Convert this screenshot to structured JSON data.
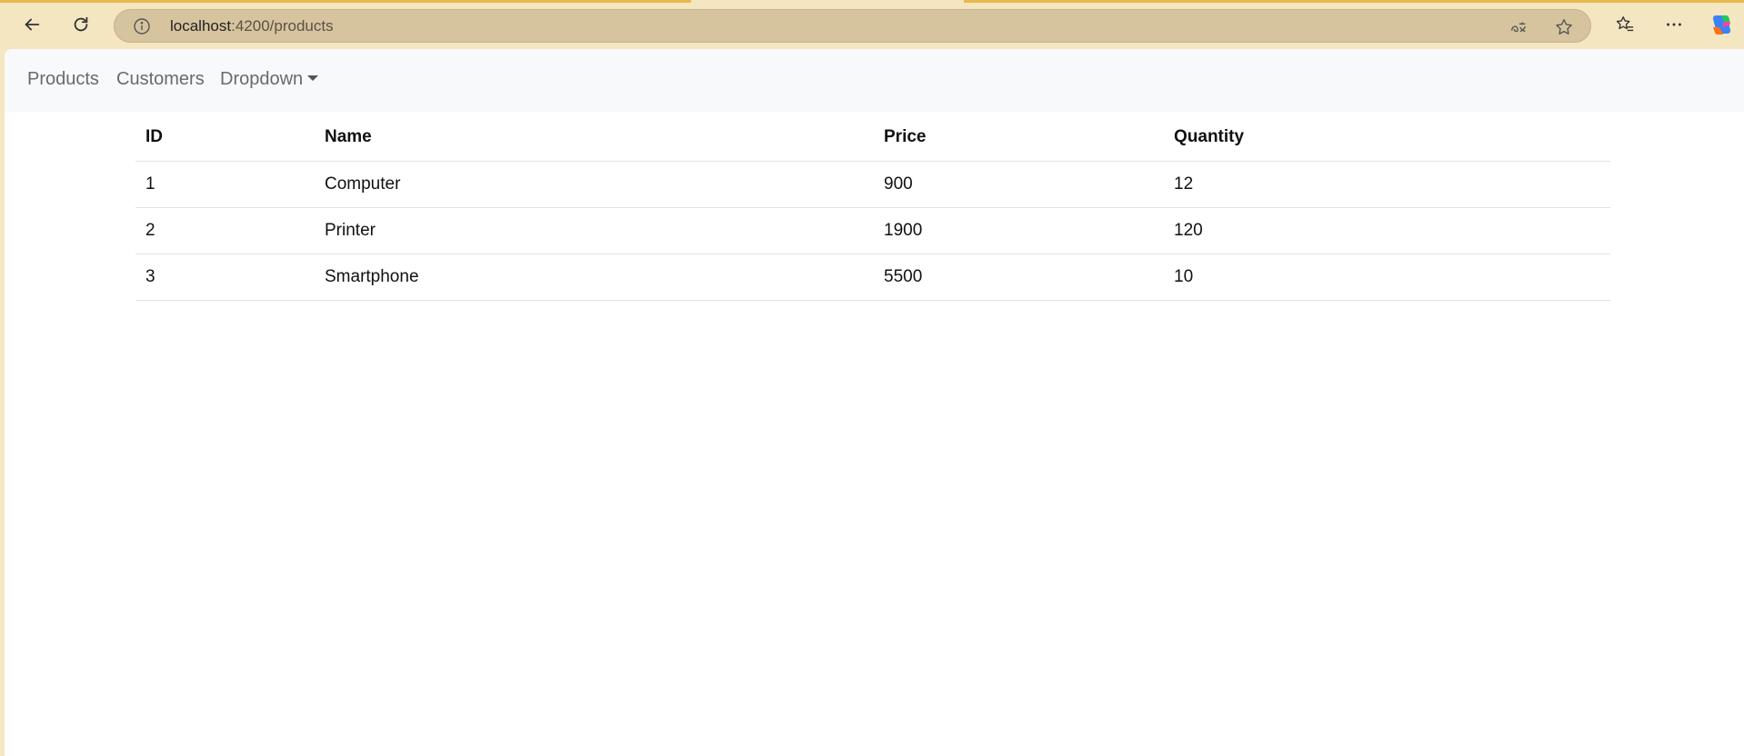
{
  "browser": {
    "url_host": "localhost",
    "url_path": ":4200/products",
    "icons": [
      "back-arrow-icon",
      "refresh-icon",
      "info-icon",
      "translate-icon",
      "star-icon",
      "favorites-icon",
      "more-icon",
      "copilot-icon"
    ]
  },
  "navbar": {
    "links": [
      {
        "label": "Products"
      },
      {
        "label": "Customers"
      },
      {
        "label": "Dropdown"
      }
    ]
  },
  "table": {
    "headers": [
      "ID",
      "Name",
      "Price",
      "Quantity"
    ],
    "rows": [
      [
        "1",
        "Computer",
        "900",
        "12"
      ],
      [
        "2",
        "Printer",
        "1900",
        "120"
      ],
      [
        "3",
        "Smartphone",
        "5500",
        "10"
      ]
    ]
  }
}
